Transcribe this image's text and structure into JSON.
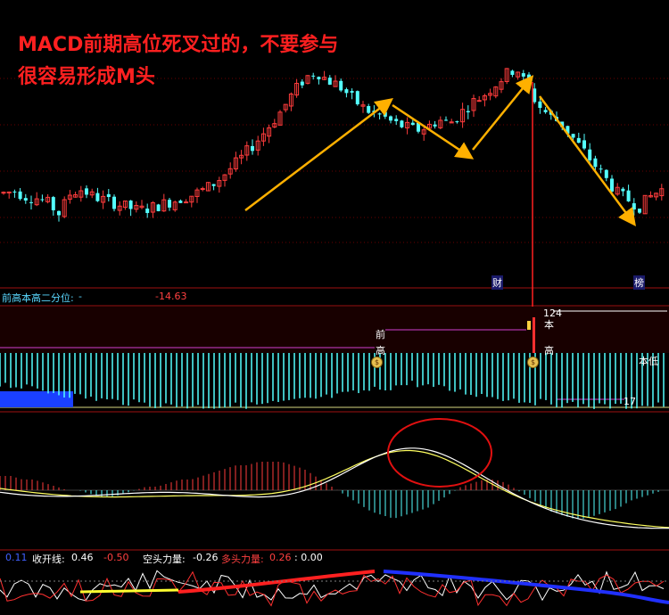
{
  "annotation": {
    "line1": "MACD前期高位死叉过的，不要参与",
    "line2": "很容易形成M头"
  },
  "colors": {
    "up": "#ff3c3c",
    "down": "#54ffff",
    "arrow": "#ffb000",
    "divider": "#a01010",
    "dif": "#ffffff",
    "dea": "#ffff60",
    "annotation_text": "#ff2020",
    "circle": "#e01010"
  },
  "events": {
    "cai_label": "财",
    "bang_label": "榜"
  },
  "indicator_panel": {
    "name": "前高本高二分位:",
    "sep": "-",
    "value": "-14.63",
    "tag_qian": "前",
    "tag_gao1": "高",
    "tag_gao2": "高",
    "tag_ben": "本",
    "tag_ben_low": "本低",
    "tag_124": "124",
    "tag_17": "17",
    "coin_glyph": "$"
  },
  "force_panel": {
    "v1": "0.11",
    "l2": "收开线:",
    "v2": "0.46",
    "v3": "-0.50",
    "l4": "空头力量:",
    "v4": "-0.26",
    "l5": "多头力量:",
    "v5": "0.26",
    "v6": ": 0.00"
  },
  "chart_data": {
    "type": "candlestick",
    "title": "",
    "price_path": [
      30,
      31,
      28,
      27,
      24,
      18,
      30,
      32,
      28,
      26,
      24,
      22,
      20,
      21,
      23,
      25,
      27,
      29,
      32,
      36,
      42,
      48,
      55,
      62,
      70,
      78,
      88,
      96,
      100,
      95,
      92,
      86,
      80,
      76,
      74,
      70,
      68,
      66,
      68,
      72,
      70,
      76,
      82,
      86,
      92,
      98,
      102,
      90,
      80,
      74,
      70,
      62,
      54,
      46,
      38,
      30,
      26,
      22,
      28,
      32
    ],
    "macd_hist": [
      4,
      4,
      3,
      3,
      2,
      1,
      0,
      0,
      -1,
      -2,
      -2,
      -1,
      0,
      1,
      1,
      2,
      3,
      3,
      4,
      5,
      6,
      7,
      7,
      8,
      8,
      8,
      7,
      6,
      4,
      2,
      0,
      -2,
      -4,
      -6,
      -7,
      -8,
      -7,
      -6,
      -5,
      -3,
      -1,
      1,
      2,
      3,
      3,
      2,
      0,
      -2,
      -4,
      -6,
      -7,
      -8,
      -8,
      -7,
      -6,
      -5,
      -3,
      -2,
      -1,
      0
    ],
    "cross_highlight": "dead cross after MACD high — M top"
  }
}
